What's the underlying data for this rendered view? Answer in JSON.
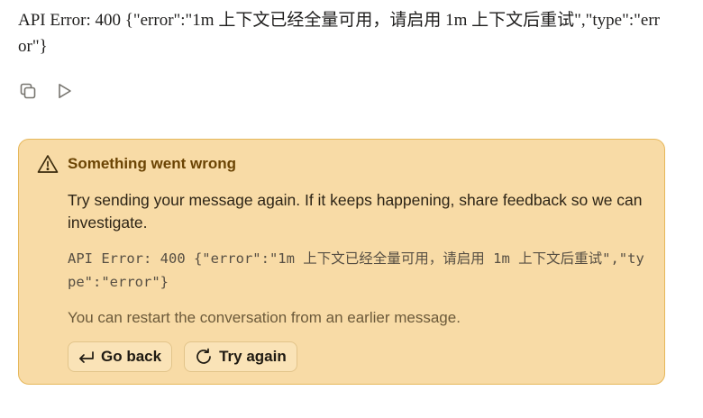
{
  "message": {
    "text": "API Error: 400 {\"error\":\"1m 上下文已经全量可用，请启用 1m 上下文后重试\",\"type\":\"error\"}"
  },
  "actions": {
    "copy_icon": "copy-icon",
    "retry_icon": "play-icon"
  },
  "error_card": {
    "title": "Something went wrong",
    "icon": "warning-triangle-icon",
    "body": "Try sending your message again. If it keeps happening, share feedback so we can investigate.",
    "code": "API Error: 400 {\"error\":\"1m 上下文已经全量可用，请启用 1m 上下文后重试\",\"type\":\"error\"}",
    "restart_note": "You can restart the conversation from an earlier message.",
    "go_back_label": "Go back",
    "try_again_label": "Try again",
    "colors": {
      "background": "#f8dba6",
      "border": "#e6b75a",
      "title": "#6b4404"
    }
  }
}
